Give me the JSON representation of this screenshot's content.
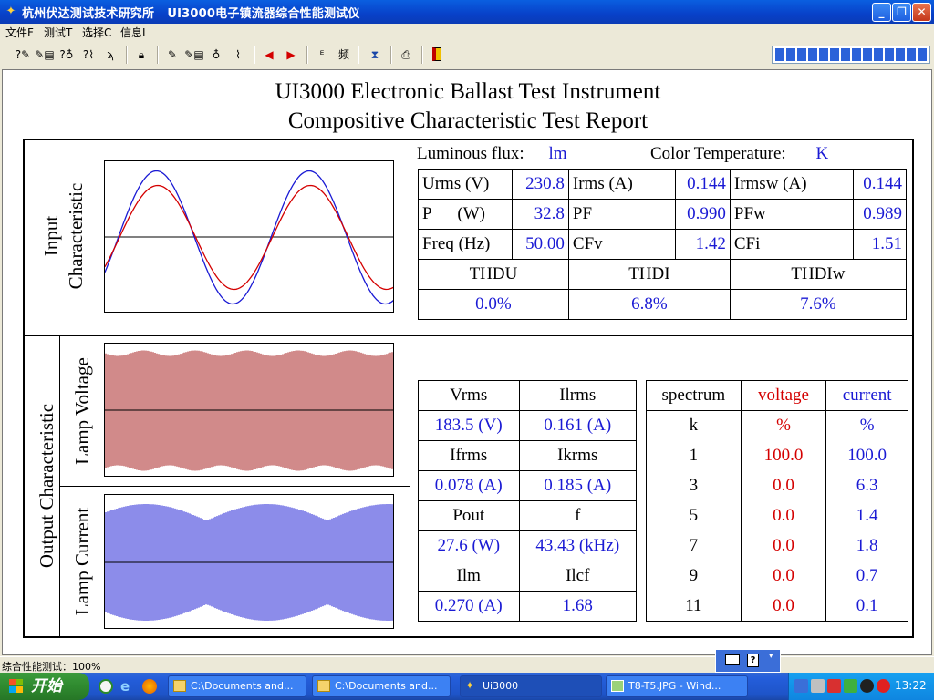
{
  "window": {
    "title": "杭州伏达测试技术研究所   UI3000电子镇流器综合性能测试仪"
  },
  "menu": [
    "文件F",
    "测试T",
    "选择C",
    "信息I"
  ],
  "report": {
    "title_line1": "UI3000 Electronic Ballast Test Instrument",
    "title_line2": "Compositive Characteristic Test Report",
    "input_label_line1": "Input",
    "input_label_line2": "Characteristic",
    "output_label": "Output Characteristic",
    "lamp_voltage_label": "Lamp Voltage",
    "lamp_current_label": "Lamp Current",
    "luminous_flux_label": "Luminous flux:",
    "luminous_flux_unit": "lm",
    "color_temp_label": "Color Temperature:",
    "color_temp_unit": "K",
    "input_table": [
      [
        {
          "l": "Urms (V)",
          "v": "230.8"
        },
        {
          "l": "Irms (A)",
          "v": "0.144"
        },
        {
          "l": "Irmsw (A)",
          "v": "0.144"
        }
      ],
      [
        {
          "l": "P      (W)",
          "v": "32.8"
        },
        {
          "l": "PF",
          "v": "0.990"
        },
        {
          "l": "PFw",
          "v": "0.989"
        }
      ],
      [
        {
          "l": "Freq (Hz)",
          "v": "50.00"
        },
        {
          "l": "CFv",
          "v": "1.42"
        },
        {
          "l": "CFi",
          "v": "1.51"
        }
      ]
    ],
    "thd_headers": [
      "THDU",
      "THDI",
      "THDIw"
    ],
    "thd_values": [
      "0.0%",
      "6.8%",
      "7.6%"
    ],
    "output_table": [
      [
        "Vrms",
        "Ilrms"
      ],
      [
        "183.5 (V)",
        "0.161 (A)"
      ],
      [
        "Ifrms",
        "Ikrms"
      ],
      [
        "0.078 (A)",
        "0.185 (A)"
      ],
      [
        "Pout",
        "f"
      ],
      [
        "27.6 (W)",
        "43.43 (kHz)"
      ],
      [
        "Ilm",
        "Ilcf"
      ],
      [
        "0.270 (A)",
        "1.68"
      ]
    ],
    "spectrum_headers": [
      "spectrum",
      "voltage",
      "current"
    ],
    "spectrum_units": [
      "k",
      "%",
      "%"
    ],
    "spectrum_rows": [
      [
        "1",
        "100.0",
        "100.0"
      ],
      [
        "3",
        "0.0",
        "6.3"
      ],
      [
        "5",
        "0.0",
        "1.4"
      ],
      [
        "7",
        "0.0",
        "1.8"
      ],
      [
        "9",
        "0.0",
        "0.7"
      ],
      [
        "11",
        "0.0",
        "0.1"
      ]
    ]
  },
  "status": {
    "text": "综合性能测试：100%"
  },
  "taskbar": {
    "start_label": "开始",
    "tasks": [
      "C:\\Documents and...",
      "C:\\Documents and...",
      "Ui3000",
      "T8-T5.JPG - Wind..."
    ],
    "clock": "13:22"
  },
  "colors": {
    "voltage_wave": "#1a1ad4",
    "current_wave": "#d40000",
    "lamp_voltage_wave": "#a31515",
    "lamp_current_wave": "#1a1ad4"
  },
  "icons": [
    "app-icon",
    "minimize-icon",
    "maximize-icon",
    "close-icon",
    "printer-icon",
    "exit-icon",
    "arrow-left-icon",
    "arrow-right-icon"
  ]
}
